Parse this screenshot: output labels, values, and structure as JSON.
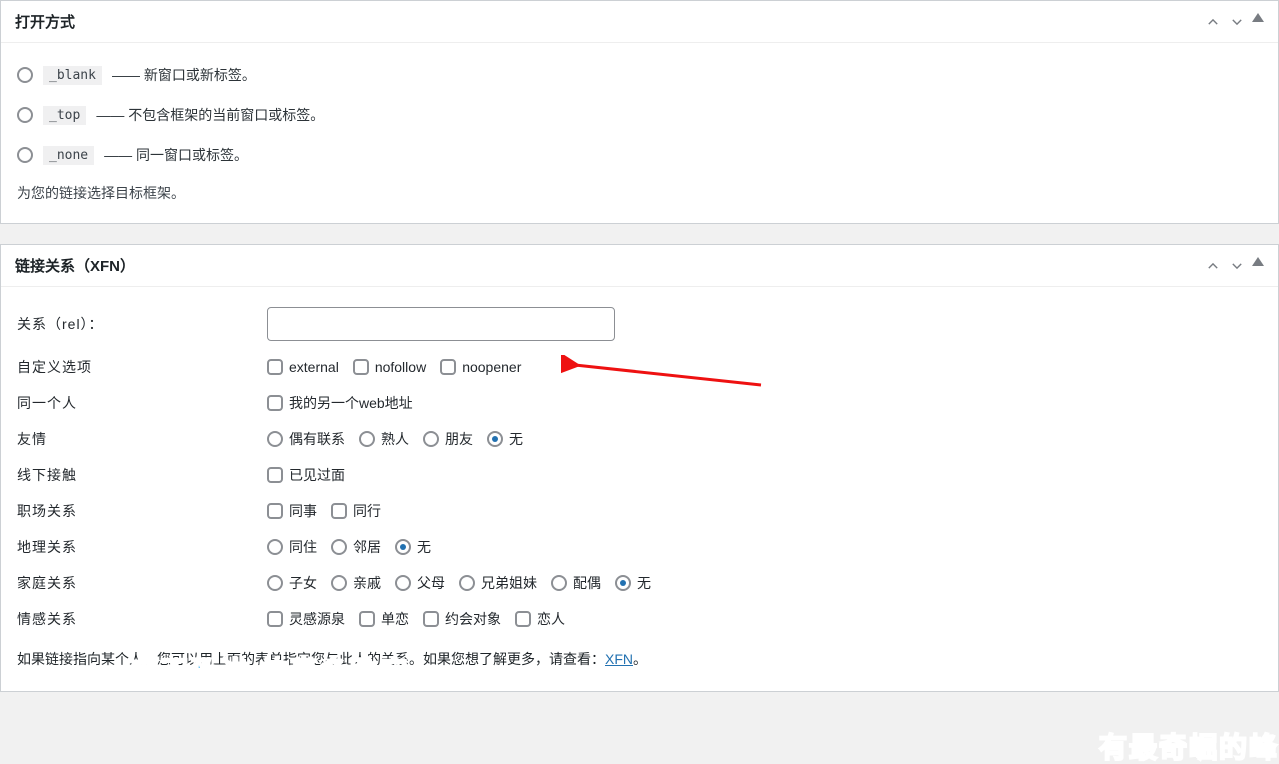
{
  "target_panel": {
    "title": "打开方式",
    "options": [
      {
        "code": "_blank",
        "desc": " —— 新窗口或新标签。"
      },
      {
        "code": "_top",
        "desc": " —— 不包含框架的当前窗口或标签。"
      },
      {
        "code": "_none",
        "desc": " —— 同一窗口或标签。"
      }
    ],
    "help": "为您的链接选择目标框架。"
  },
  "xfn_panel": {
    "title": "链接关系（XFN）",
    "rel_label": "关系（rel）：",
    "rel_value": "",
    "custom_label": "自定义选项",
    "custom_options": [
      "external",
      "nofollow",
      "noopener"
    ],
    "identity_label": "同一个人",
    "identity_option": "我的另一个web地址",
    "friendship_label": "友情",
    "friendship_options": [
      "偶有联系",
      "熟人",
      "朋友",
      "无"
    ],
    "friendship_selected": 3,
    "physical_label": "线下接触",
    "physical_option": "已见过面",
    "professional_label": "职场关系",
    "professional_options": [
      "同事",
      "同行"
    ],
    "geo_label": "地理关系",
    "geo_options": [
      "同住",
      "邻居",
      "无"
    ],
    "geo_selected": 2,
    "family_label": "家庭关系",
    "family_options": [
      "子女",
      "亲戚",
      "父母",
      "兄弟姐妹",
      "配偶",
      "无"
    ],
    "family_selected": 5,
    "romantic_label": "情感关系",
    "romantic_options": [
      "灵感源泉",
      "单恋",
      "约会对象",
      "恋人"
    ],
    "footer_prefix": "如果链接指向某个人，您可以用上面的表单指定您与此人的关系。如果您想了解更多，请查看：",
    "footer_link": "XFN",
    "footer_suffix": "。"
  },
  "watermarks": {
    "w1": "来不及讲  故事多跌宕",
    "w2": "有最奇崛的峰"
  }
}
